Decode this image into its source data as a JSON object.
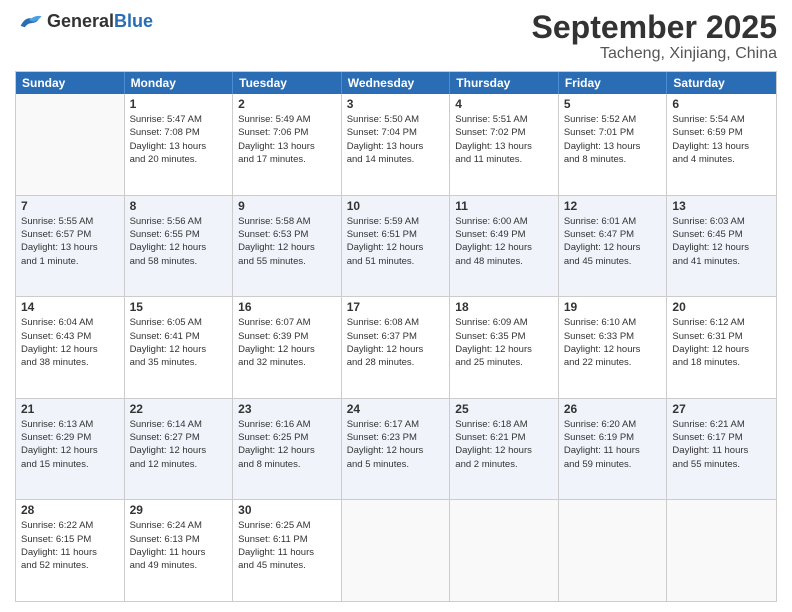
{
  "logo": {
    "text_general": "General",
    "text_blue": "Blue"
  },
  "title": "September 2025",
  "subtitle": "Tacheng, Xinjiang, China",
  "header_days": [
    "Sunday",
    "Monday",
    "Tuesday",
    "Wednesday",
    "Thursday",
    "Friday",
    "Saturday"
  ],
  "weeks": [
    [
      {
        "day": "",
        "info": ""
      },
      {
        "day": "1",
        "info": "Sunrise: 5:47 AM\nSunset: 7:08 PM\nDaylight: 13 hours\nand 20 minutes."
      },
      {
        "day": "2",
        "info": "Sunrise: 5:49 AM\nSunset: 7:06 PM\nDaylight: 13 hours\nand 17 minutes."
      },
      {
        "day": "3",
        "info": "Sunrise: 5:50 AM\nSunset: 7:04 PM\nDaylight: 13 hours\nand 14 minutes."
      },
      {
        "day": "4",
        "info": "Sunrise: 5:51 AM\nSunset: 7:02 PM\nDaylight: 13 hours\nand 11 minutes."
      },
      {
        "day": "5",
        "info": "Sunrise: 5:52 AM\nSunset: 7:01 PM\nDaylight: 13 hours\nand 8 minutes."
      },
      {
        "day": "6",
        "info": "Sunrise: 5:54 AM\nSunset: 6:59 PM\nDaylight: 13 hours\nand 4 minutes."
      }
    ],
    [
      {
        "day": "7",
        "info": "Sunrise: 5:55 AM\nSunset: 6:57 PM\nDaylight: 13 hours\nand 1 minute."
      },
      {
        "day": "8",
        "info": "Sunrise: 5:56 AM\nSunset: 6:55 PM\nDaylight: 12 hours\nand 58 minutes."
      },
      {
        "day": "9",
        "info": "Sunrise: 5:58 AM\nSunset: 6:53 PM\nDaylight: 12 hours\nand 55 minutes."
      },
      {
        "day": "10",
        "info": "Sunrise: 5:59 AM\nSunset: 6:51 PM\nDaylight: 12 hours\nand 51 minutes."
      },
      {
        "day": "11",
        "info": "Sunrise: 6:00 AM\nSunset: 6:49 PM\nDaylight: 12 hours\nand 48 minutes."
      },
      {
        "day": "12",
        "info": "Sunrise: 6:01 AM\nSunset: 6:47 PM\nDaylight: 12 hours\nand 45 minutes."
      },
      {
        "day": "13",
        "info": "Sunrise: 6:03 AM\nSunset: 6:45 PM\nDaylight: 12 hours\nand 41 minutes."
      }
    ],
    [
      {
        "day": "14",
        "info": "Sunrise: 6:04 AM\nSunset: 6:43 PM\nDaylight: 12 hours\nand 38 minutes."
      },
      {
        "day": "15",
        "info": "Sunrise: 6:05 AM\nSunset: 6:41 PM\nDaylight: 12 hours\nand 35 minutes."
      },
      {
        "day": "16",
        "info": "Sunrise: 6:07 AM\nSunset: 6:39 PM\nDaylight: 12 hours\nand 32 minutes."
      },
      {
        "day": "17",
        "info": "Sunrise: 6:08 AM\nSunset: 6:37 PM\nDaylight: 12 hours\nand 28 minutes."
      },
      {
        "day": "18",
        "info": "Sunrise: 6:09 AM\nSunset: 6:35 PM\nDaylight: 12 hours\nand 25 minutes."
      },
      {
        "day": "19",
        "info": "Sunrise: 6:10 AM\nSunset: 6:33 PM\nDaylight: 12 hours\nand 22 minutes."
      },
      {
        "day": "20",
        "info": "Sunrise: 6:12 AM\nSunset: 6:31 PM\nDaylight: 12 hours\nand 18 minutes."
      }
    ],
    [
      {
        "day": "21",
        "info": "Sunrise: 6:13 AM\nSunset: 6:29 PM\nDaylight: 12 hours\nand 15 minutes."
      },
      {
        "day": "22",
        "info": "Sunrise: 6:14 AM\nSunset: 6:27 PM\nDaylight: 12 hours\nand 12 minutes."
      },
      {
        "day": "23",
        "info": "Sunrise: 6:16 AM\nSunset: 6:25 PM\nDaylight: 12 hours\nand 8 minutes."
      },
      {
        "day": "24",
        "info": "Sunrise: 6:17 AM\nSunset: 6:23 PM\nDaylight: 12 hours\nand 5 minutes."
      },
      {
        "day": "25",
        "info": "Sunrise: 6:18 AM\nSunset: 6:21 PM\nDaylight: 12 hours\nand 2 minutes."
      },
      {
        "day": "26",
        "info": "Sunrise: 6:20 AM\nSunset: 6:19 PM\nDaylight: 11 hours\nand 59 minutes."
      },
      {
        "day": "27",
        "info": "Sunrise: 6:21 AM\nSunset: 6:17 PM\nDaylight: 11 hours\nand 55 minutes."
      }
    ],
    [
      {
        "day": "28",
        "info": "Sunrise: 6:22 AM\nSunset: 6:15 PM\nDaylight: 11 hours\nand 52 minutes."
      },
      {
        "day": "29",
        "info": "Sunrise: 6:24 AM\nSunset: 6:13 PM\nDaylight: 11 hours\nand 49 minutes."
      },
      {
        "day": "30",
        "info": "Sunrise: 6:25 AM\nSunset: 6:11 PM\nDaylight: 11 hours\nand 45 minutes."
      },
      {
        "day": "",
        "info": ""
      },
      {
        "day": "",
        "info": ""
      },
      {
        "day": "",
        "info": ""
      },
      {
        "day": "",
        "info": ""
      }
    ]
  ]
}
